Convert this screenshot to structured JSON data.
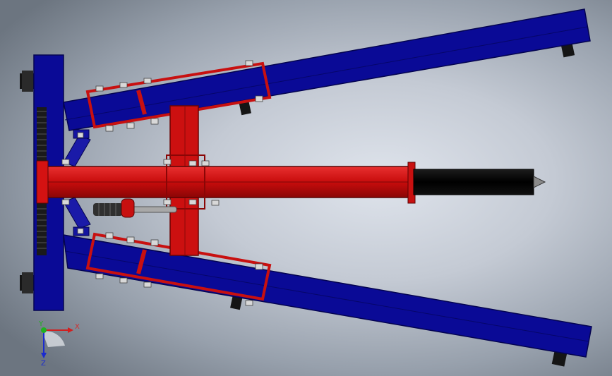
{
  "viewport": {
    "background_top": "#dfe4ec",
    "background_edge": "#6c7580"
  },
  "colors": {
    "frame_blue": "#0a0a96",
    "frame_blue_dark": "#050560",
    "beam_red": "#d01010",
    "beam_red_dark": "#7a0606",
    "cylinder_black": "#050505",
    "rod_grey": "#a8a8a8",
    "spring_dark": "#303030"
  },
  "triad": {
    "x_label": "X",
    "y_label": "Y",
    "z_label": "Z",
    "x_color": "#d02020",
    "y_color": "#20b020",
    "z_color": "#1a2ad0"
  }
}
